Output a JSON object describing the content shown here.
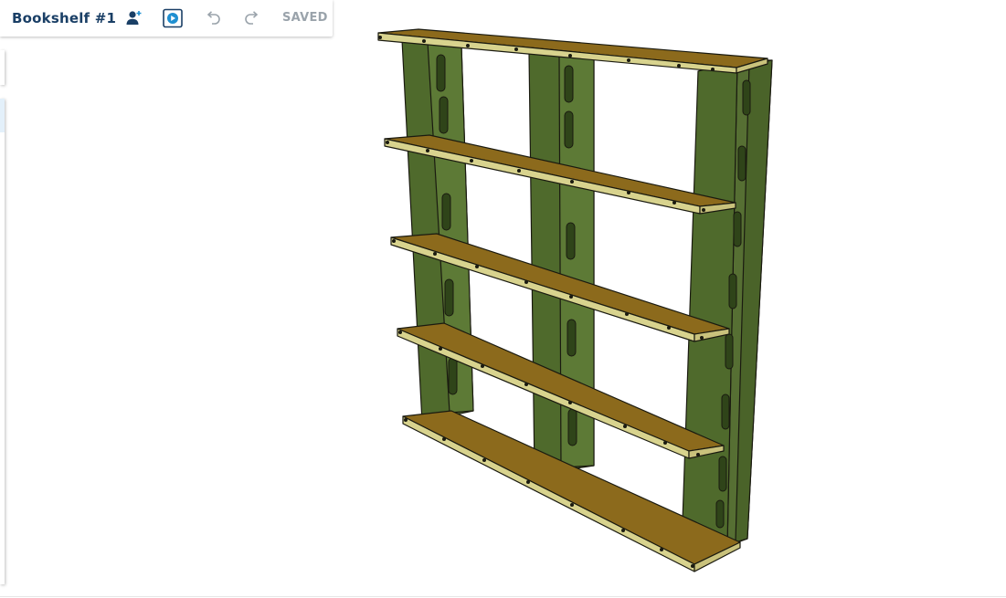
{
  "toolbar": {
    "document_title": "Bookshelf #1",
    "add_collaborator_icon": "person-plus-icon",
    "play_icon": "play-icon",
    "undo_icon": "undo-icon",
    "redo_icon": "redo-icon",
    "save_status": "SAVED"
  },
  "viewport": {
    "model": "bookshelf",
    "colors": {
      "uprights": "#4f6a2c",
      "shelf_top": "#8c6a1c",
      "shelf_edge": "#d8d38e",
      "accent": "#1f8fd1"
    }
  }
}
